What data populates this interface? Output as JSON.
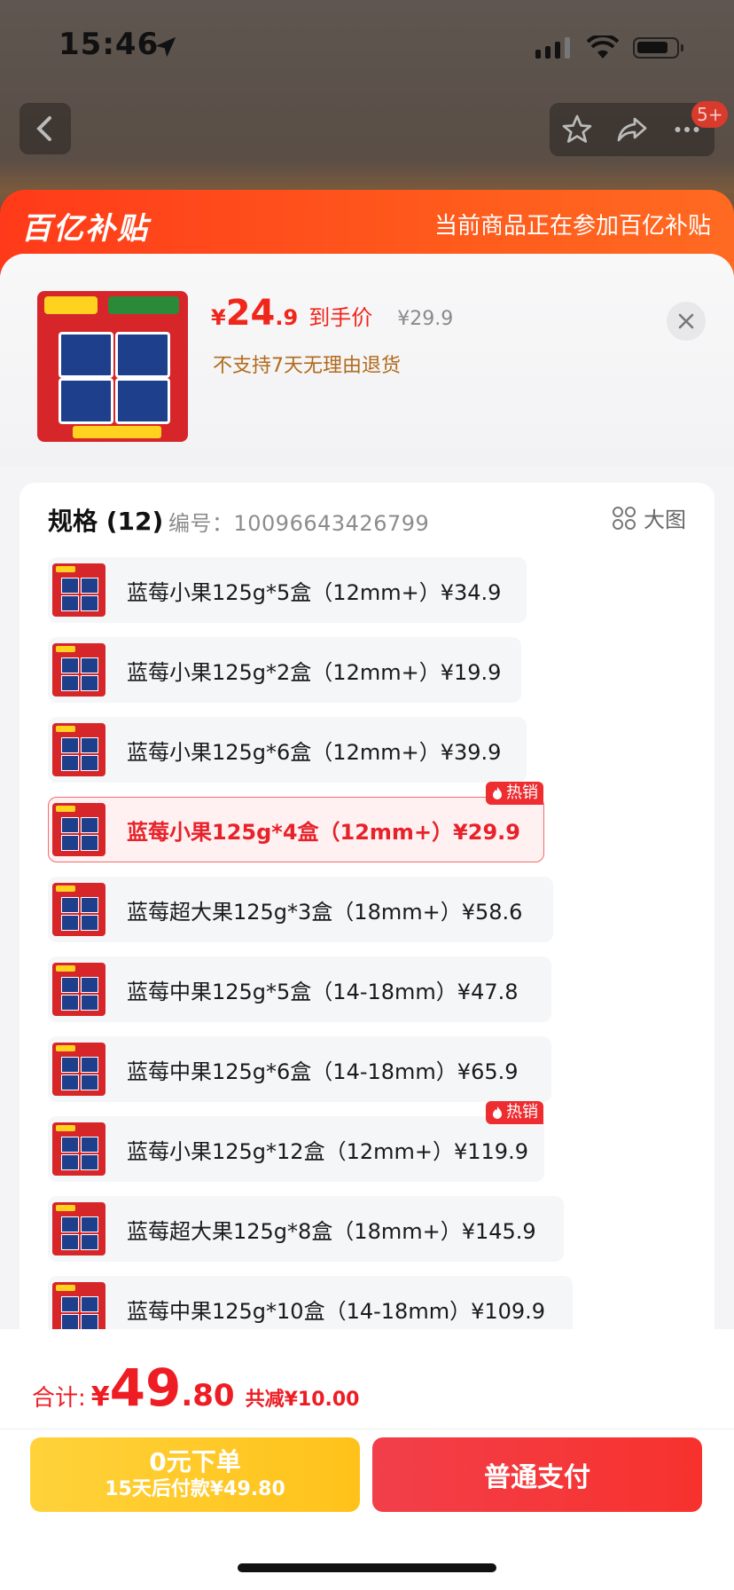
{
  "status_bar": {
    "time": "15:46"
  },
  "nav": {
    "cart_badge": "5+"
  },
  "header": {
    "logo": "百亿补贴",
    "slogan": "当前商品正在参加百亿补贴"
  },
  "product": {
    "price_yen": "¥",
    "price_int": "24",
    "price_dec": ".9",
    "price_label": "到手价",
    "original_price": "¥29.9",
    "return_note": "不支持7天无理由退货"
  },
  "specs": {
    "title": "规格 (12)",
    "code_label": "编号：10096643426799",
    "big_view_label": "大图",
    "hot_label": "热销",
    "options": [
      {
        "label": "蓝莓小果125g*5盒（12mm+）¥34.9",
        "selected": false,
        "hot": false
      },
      {
        "label": "蓝莓小果125g*2盒（12mm+）¥19.9",
        "selected": false,
        "hot": false
      },
      {
        "label": "蓝莓小果125g*6盒（12mm+）¥39.9",
        "selected": false,
        "hot": false
      },
      {
        "label": "蓝莓小果125g*4盒（12mm+）¥29.9",
        "selected": true,
        "hot": true
      },
      {
        "label": "蓝莓超大果125g*3盒（18mm+）¥58.6",
        "selected": false,
        "hot": false
      },
      {
        "label": "蓝莓中果125g*5盒（14-18mm）¥47.8",
        "selected": false,
        "hot": false
      },
      {
        "label": "蓝莓中果125g*6盒（14-18mm）¥65.9",
        "selected": false,
        "hot": false
      },
      {
        "label": "蓝莓小果125g*12盒（12mm+）¥119.9",
        "selected": false,
        "hot": true
      },
      {
        "label": "蓝莓超大果125g*8盒（18mm+）¥145.9",
        "selected": false,
        "hot": false
      },
      {
        "label": "蓝莓中果125g*10盒（14-18mm）¥109.9",
        "selected": false,
        "hot": false
      }
    ]
  },
  "footer": {
    "total_label": "合计:",
    "total_yen": "¥",
    "total_int": "49",
    "total_dec": ".80",
    "discount": "共减¥10.00",
    "pay_later_line1": "0元下单",
    "pay_later_line2": "15天后付款¥49.80",
    "pay_label": "普通支付"
  },
  "colors": {
    "accent": "#f0261b",
    "header_orange": "#ff4a1c",
    "pay_later_yellow": "#ffc21a",
    "pay_red": "#f23a3a"
  }
}
